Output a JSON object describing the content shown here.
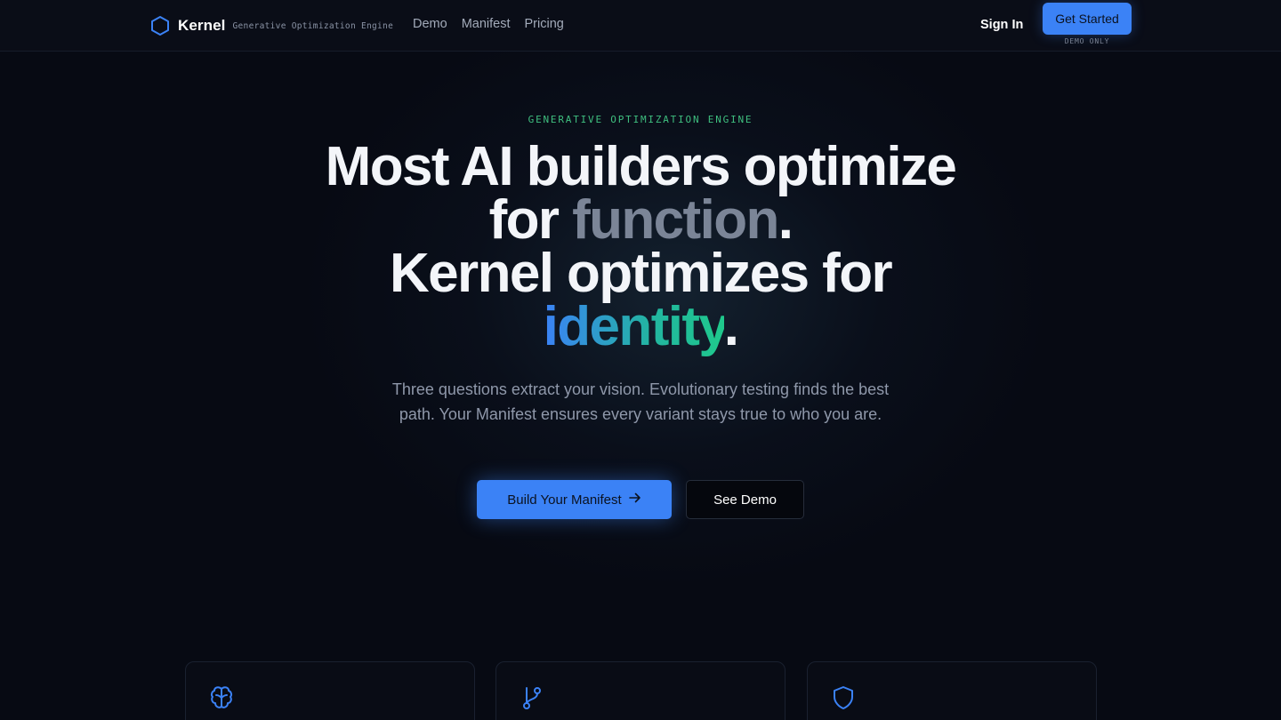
{
  "header": {
    "brand_name": "Kernel",
    "brand_tagline": "Generative Optimization Engine",
    "nav": [
      {
        "label": "Demo"
      },
      {
        "label": "Manifest"
      },
      {
        "label": "Pricing"
      }
    ],
    "sign_in_label": "Sign In",
    "get_started_label": "Get Started",
    "demo_only_label": "DEMO ONLY"
  },
  "hero": {
    "eyebrow": "GENERATIVE OPTIMIZATION ENGINE",
    "headline_line1": "Most AI builders optimize",
    "headline_for": "for ",
    "headline_function": "function",
    "headline_period1": ".",
    "headline_line3": "Kernel optimizes for",
    "headline_identity": "identity",
    "headline_period2": ".",
    "subcopy": "Three questions extract your vision. Evolutionary testing finds the best path. Your Manifest ensures every variant stays true to who you are.",
    "primary_cta": "Build Your Manifest",
    "secondary_cta": "See Demo"
  },
  "features": [
    {
      "icon": "brain-icon"
    },
    {
      "icon": "git-branch-icon"
    },
    {
      "icon": "shield-icon"
    }
  ],
  "colors": {
    "accent": "#3b82f6",
    "eyebrow": "#3fbf7f",
    "gradient_start": "#3b82f6",
    "gradient_end": "#1fc98c",
    "background": "#070a13"
  }
}
